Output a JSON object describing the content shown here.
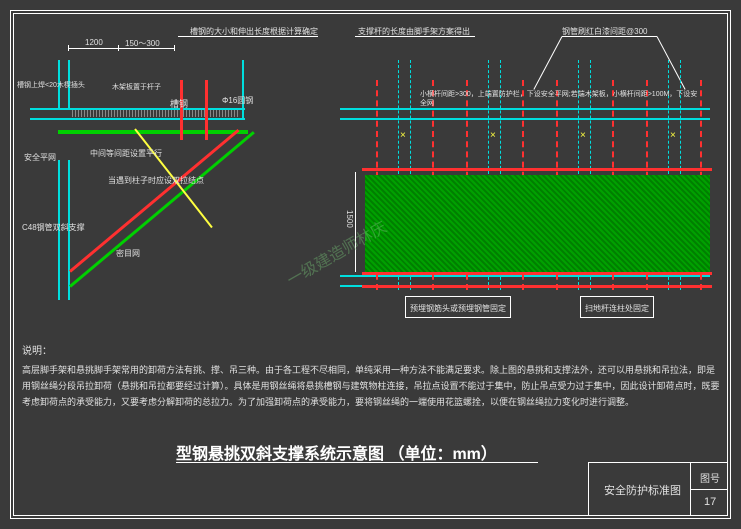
{
  "top_labels": {
    "dim_1200": "1200",
    "dim_150_300": "150～300",
    "note_cantilever": "槽钢的大小和伸出长度根据计算确定",
    "note_brace_length": "支撑杆的长度由脚手架方案得出",
    "note_tube_paint": "钢管刷红白漆间距@300"
  },
  "left_section": {
    "wedge_note": "槽钢上焊<20木楔插头",
    "wood_note": "木架板置于杆子",
    "channel_steel": "槽钢",
    "phi16": "Φ16圆钢",
    "safety_net": "安全平网",
    "mid_parallel": "中间等间距设置平行",
    "double_tie": "当遇到柱子时应设双拉结点",
    "c48_brace": "C48钢管双斜支撑",
    "dense_net": "密目网"
  },
  "right_section": {
    "ledger_note": "小横杆间距>300，上端置防护栏，下设安全平网;若端木架板，小横杆间距>100M，下设安全网",
    "dim_1500": "1500",
    "embed_note": "预埋钢筋头或预埋钢管固定",
    "sweep_note": "扫地杆连柱处固定"
  },
  "description": {
    "heading": "说明：",
    "body": "高层脚手架和悬挑脚手架常用的卸荷方法有挑、撑、吊三种。由于各工程不尽相同，单纯采用一种方法不能满足要求。除上图的悬挑和支撑法外，还可以用悬挑和吊拉法，即是用钢丝绳分段吊拉卸荷（悬挑和吊拉都要经过计算）。具体是用钢丝绳将悬挑槽钢与建筑物柱连接，吊拉点设置不能过于集中，防止吊点受力过于集中，因此设计卸荷点时，既要考虑卸荷点的承受能力，又要考虑分解卸荷的总拉力。为了加强卸荷点的承受能力，要将钢丝绳的一端使用花篮螺拴，以便在钢丝绳拉力变化时进行调整。"
  },
  "main_title": "型钢悬挑双斜支撑系统示意图 （单位：mm）",
  "title_block": {
    "drawing_name": "安全防护标准图",
    "sheet_label": "图号",
    "sheet_num": "17"
  },
  "watermark": "一级建造师林庆"
}
